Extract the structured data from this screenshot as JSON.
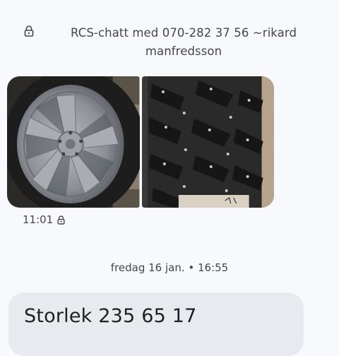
{
  "header": {
    "title": "RCS-chatt med 070-282 37 56 ~rikard manfredsson",
    "lock_icon": "lock-icon"
  },
  "message_images": {
    "items": [
      {
        "name": "alloy-wheel-photo"
      },
      {
        "name": "studded-winter-tire-photo"
      }
    ],
    "sent_time": "11:01",
    "status_icon": "lock-icon"
  },
  "divider": {
    "label": "fredag 16 jan. • 16:55"
  },
  "message": {
    "text": "Storlek 235 65 17"
  },
  "colors": {
    "background": "#f8f9fd",
    "bubble": "#e8eaf0",
    "text": "#444746"
  }
}
